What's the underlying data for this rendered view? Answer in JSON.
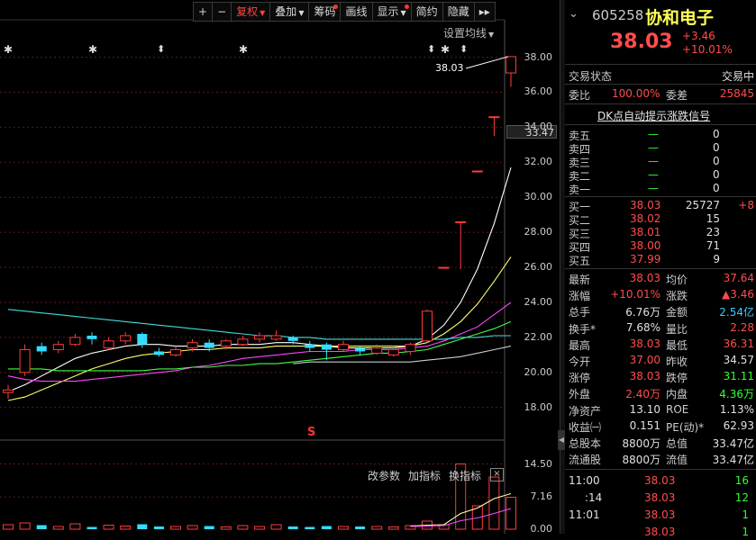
{
  "toolbar": {
    "buttons": [
      {
        "label": "+",
        "active": false,
        "dot": false,
        "caret": false
      },
      {
        "label": "−",
        "active": false,
        "dot": false,
        "caret": false
      },
      {
        "label": "复权",
        "active": true,
        "dot": false,
        "caret": true
      },
      {
        "label": "叠加",
        "active": false,
        "dot": false,
        "caret": true
      },
      {
        "label": "筹码",
        "active": false,
        "dot": true,
        "caret": false
      },
      {
        "label": "画线",
        "active": false,
        "dot": false,
        "caret": false
      },
      {
        "label": "显示",
        "active": false,
        "dot": true,
        "caret": true
      },
      {
        "label": "简约",
        "active": false,
        "dot": false,
        "caret": false
      },
      {
        "label": "隐藏",
        "active": false,
        "dot": false,
        "caret": false
      },
      {
        "label": "▸▸",
        "active": false,
        "dot": false,
        "caret": false
      }
    ]
  },
  "chart": {
    "ma_setting": "设置均线",
    "high_label": "38.03",
    "price_tag": "33.47",
    "s_marker": "S",
    "indicator_buttons": [
      "改参数",
      "加指标",
      "换指标"
    ],
    "close_glyph": "×",
    "star_glyph": "✱",
    "arrow_glyph": "⬍"
  },
  "chart_data": {
    "type": "candlestick",
    "price_axis": {
      "ticks": [
        "38.00",
        "36.00",
        "34.00",
        "32.00",
        "30.00",
        "28.00",
        "26.00",
        "24.00",
        "22.00",
        "20.00",
        "18.00"
      ],
      "ylim": [
        16.6,
        38.9
      ]
    },
    "volume_axis": {
      "ticks": [
        "14.50",
        "7.16",
        "0.00"
      ]
    },
    "candles": [
      {
        "o": 18.85,
        "c": 19.0,
        "h": 19.3,
        "l": 18.5
      },
      {
        "o": 20.0,
        "c": 21.3,
        "h": 21.6,
        "l": 19.8
      },
      {
        "o": 21.5,
        "c": 21.2,
        "h": 21.7,
        "l": 21.0
      },
      {
        "o": 21.3,
        "c": 21.6,
        "h": 21.8,
        "l": 21.1
      },
      {
        "o": 21.6,
        "c": 22.0,
        "h": 22.2,
        "l": 21.5
      },
      {
        "o": 22.1,
        "c": 21.9,
        "h": 22.3,
        "l": 21.6
      },
      {
        "o": 21.4,
        "c": 21.8,
        "h": 22.0,
        "l": 21.3
      },
      {
        "o": 21.8,
        "c": 22.1,
        "h": 22.3,
        "l": 21.6
      },
      {
        "o": 22.2,
        "c": 21.6,
        "h": 22.3,
        "l": 21.4
      },
      {
        "o": 21.2,
        "c": 21.0,
        "h": 21.4,
        "l": 20.9
      },
      {
        "o": 21.0,
        "c": 21.3,
        "h": 21.5,
        "l": 20.9
      },
      {
        "o": 21.4,
        "c": 21.7,
        "h": 21.9,
        "l": 21.2
      },
      {
        "o": 21.7,
        "c": 21.4,
        "h": 21.9,
        "l": 21.2
      },
      {
        "o": 21.5,
        "c": 21.8,
        "h": 21.9,
        "l": 21.3
      },
      {
        "o": 21.6,
        "c": 21.9,
        "h": 22.1,
        "l": 21.5
      },
      {
        "o": 21.9,
        "c": 22.1,
        "h": 22.3,
        "l": 21.7
      },
      {
        "o": 21.9,
        "c": 22.1,
        "h": 22.4,
        "l": 21.8
      },
      {
        "o": 22.0,
        "c": 21.8,
        "h": 22.1,
        "l": 21.6
      },
      {
        "o": 21.6,
        "c": 21.4,
        "h": 21.8,
        "l": 21.2
      },
      {
        "o": 21.6,
        "c": 21.3,
        "h": 21.7,
        "l": 20.7
      },
      {
        "o": 21.3,
        "c": 21.6,
        "h": 21.8,
        "l": 21.2
      },
      {
        "o": 21.4,
        "c": 21.2,
        "h": 21.5,
        "l": 21.0
      },
      {
        "o": 21.1,
        "c": 21.4,
        "h": 21.6,
        "l": 21.0
      },
      {
        "o": 21.0,
        "c": 21.3,
        "h": 21.5,
        "l": 20.9
      },
      {
        "o": 21.2,
        "c": 21.6,
        "h": 21.7,
        "l": 21.0
      },
      {
        "o": 21.8,
        "c": 23.5,
        "h": 23.6,
        "l": 21.7
      },
      {
        "o": 26.0,
        "c": 26.0,
        "h": 26.0,
        "l": 26.0
      },
      {
        "o": 28.6,
        "c": 28.6,
        "h": 28.6,
        "l": 25.9
      },
      {
        "o": 31.5,
        "c": 31.5,
        "h": 31.5,
        "l": 31.5
      },
      {
        "o": 34.6,
        "c": 34.6,
        "h": 34.6,
        "l": 33.5
      },
      {
        "o": 37.1,
        "c": 38.03,
        "h": 38.03,
        "l": 36.31
      }
    ],
    "ma_lines": [
      {
        "color": "#ffffff",
        "values": [
          18.9,
          19.3,
          19.8,
          20.3,
          20.8,
          21.1,
          21.3,
          21.5,
          21.6,
          21.6,
          21.5,
          21.5,
          21.5,
          21.6,
          21.6,
          21.6,
          21.7,
          21.7,
          21.6,
          21.5,
          21.4,
          21.4,
          21.4,
          21.4,
          21.5,
          21.9,
          22.7,
          24.0,
          25.9,
          28.5,
          31.7
        ]
      },
      {
        "color": "#ffff66",
        "values": [
          18.4,
          18.6,
          19.0,
          19.4,
          19.8,
          20.2,
          20.5,
          20.8,
          21.0,
          21.1,
          21.2,
          21.3,
          21.3,
          21.4,
          21.4,
          21.4,
          21.5,
          21.5,
          21.5,
          21.5,
          21.5,
          21.5,
          21.5,
          21.5,
          21.5,
          21.7,
          22.2,
          22.9,
          23.9,
          25.2,
          26.6
        ]
      },
      {
        "color": "#ff44ff",
        "values": [
          19.8,
          19.6,
          19.5,
          19.5,
          19.5,
          19.6,
          19.7,
          19.8,
          19.9,
          20.0,
          20.1,
          20.3,
          20.4,
          20.6,
          20.8,
          20.9,
          21.0,
          21.1,
          21.2,
          21.2,
          21.2,
          21.3,
          21.3,
          21.3,
          21.4,
          21.5,
          21.8,
          22.2,
          22.6,
          23.3,
          24.0
        ]
      },
      {
        "color": "#44ff44",
        "values": [
          20.2,
          20.2,
          20.2,
          20.1,
          20.1,
          20.1,
          20.1,
          20.1,
          20.1,
          20.2,
          20.2,
          20.3,
          20.3,
          20.4,
          20.4,
          20.5,
          20.5,
          20.6,
          20.7,
          20.8,
          20.9,
          21.0,
          21.1,
          21.1,
          21.2,
          21.3,
          21.6,
          21.9,
          22.2,
          22.5,
          22.9
        ]
      },
      {
        "color": "#44dddd",
        "values": [
          23.6,
          23.5,
          23.4,
          23.3,
          23.2,
          23.1,
          23.0,
          22.9,
          22.8,
          22.7,
          22.6,
          22.5,
          22.4,
          22.3,
          22.2,
          22.1,
          22.1,
          22.0,
          22.0,
          21.9,
          21.9,
          21.9,
          21.9,
          21.9,
          21.9,
          21.9,
          21.9,
          22.0,
          22.0,
          22.1,
          22.1
        ]
      },
      {
        "color": "#cccccc",
        "values": [
          null,
          null,
          null,
          null,
          null,
          null,
          null,
          null,
          null,
          null,
          null,
          null,
          null,
          null,
          null,
          null,
          null,
          20.5,
          20.6,
          20.6,
          20.6,
          20.6,
          20.6,
          20.6,
          20.6,
          20.7,
          20.8,
          20.9,
          21.1,
          21.3,
          21.5
        ]
      }
    ],
    "volume": [
      1.0,
      1.4,
      0.9,
      0.6,
      1.2,
      0.5,
      0.9,
      0.7,
      1.1,
      0.6,
      0.6,
      0.8,
      0.7,
      0.5,
      0.8,
      0.6,
      1.0,
      0.6,
      0.5,
      0.7,
      0.6,
      0.6,
      0.6,
      0.5,
      0.8,
      1.8,
      1.0,
      14.5,
      5.2,
      11.6,
      7.1
    ],
    "volume_ma": [
      {
        "color": "#ffffaa",
        "values": [
          null,
          null,
          null,
          null,
          null,
          null,
          null,
          null,
          null,
          null,
          null,
          null,
          null,
          null,
          null,
          null,
          null,
          null,
          null,
          null,
          null,
          null,
          null,
          null,
          0.7,
          0.9,
          1.0,
          3.5,
          4.7,
          6.8,
          7.9
        ]
      },
      {
        "color": "#ff44ff",
        "values": [
          null,
          null,
          null,
          null,
          null,
          null,
          null,
          null,
          null,
          null,
          null,
          null,
          null,
          null,
          null,
          null,
          null,
          null,
          null,
          null,
          null,
          null,
          null,
          null,
          0.6,
          0.7,
          0.8,
          1.9,
          2.5,
          3.5,
          4.6
        ]
      }
    ]
  },
  "quote": {
    "code": "605258",
    "name": "协和电子",
    "price": "38.03",
    "change": "+3.46",
    "change_pct": "+10.01%",
    "status_label": "交易状态",
    "status_value": "交易中",
    "wb_label": "委比",
    "wb_value": "100.00%",
    "wc_label": "委差",
    "wc_value": "25845",
    "signal_link": "DK点自动提示涨跌信号",
    "asks": [
      {
        "label": "卖五",
        "price": "—",
        "vol": "0"
      },
      {
        "label": "卖四",
        "price": "—",
        "vol": "0"
      },
      {
        "label": "卖三",
        "price": "—",
        "vol": "0"
      },
      {
        "label": "卖二",
        "price": "—",
        "vol": "0"
      },
      {
        "label": "卖一",
        "price": "—",
        "vol": "0"
      }
    ],
    "bids": [
      {
        "label": "买一",
        "price": "38.03",
        "vol": "25727",
        "diff": "+8"
      },
      {
        "label": "买二",
        "price": "38.02",
        "vol": "15",
        "diff": ""
      },
      {
        "label": "买三",
        "price": "38.01",
        "vol": "23",
        "diff": ""
      },
      {
        "label": "买四",
        "price": "38.00",
        "vol": "71",
        "diff": ""
      },
      {
        "label": "买五",
        "price": "37.99",
        "vol": "9",
        "diff": ""
      }
    ],
    "stats": [
      {
        "l1": "最新",
        "v1": "38.03",
        "c1": "r",
        "l2": "均价",
        "v2": "37.64",
        "c2": "r"
      },
      {
        "l1": "涨幅",
        "v1": "+10.01%",
        "c1": "r",
        "l2": "涨跌",
        "v2": "▲3.46",
        "c2": "r"
      },
      {
        "l1": "总手",
        "v1": "6.76万",
        "c1": "w",
        "l2": "金额",
        "v2": "2.54亿",
        "c2": "c"
      },
      {
        "l1": "换手*",
        "v1": "7.68%",
        "c1": "w",
        "l2": "量比",
        "v2": "2.28",
        "c2": "r"
      },
      {
        "l1": "最高",
        "v1": "38.03",
        "c1": "r",
        "l2": "最低",
        "v2": "36.31",
        "c2": "r"
      },
      {
        "l1": "今开",
        "v1": "37.00",
        "c1": "r",
        "l2": "昨收",
        "v2": "34.57",
        "c2": "w"
      },
      {
        "l1": "涨停",
        "v1": "38.03",
        "c1": "r",
        "l2": "跌停",
        "v2": "31.11",
        "c2": "g"
      },
      {
        "l1": "外盘",
        "v1": "2.40万",
        "c1": "r",
        "l2": "内盘",
        "v2": "4.36万",
        "c2": "g"
      },
      {
        "l1": "净资产",
        "v1": "13.10",
        "c1": "w",
        "l2": "ROE",
        "v2": "1.13%",
        "c2": "w"
      },
      {
        "l1": "收益㈠",
        "v1": "0.151",
        "c1": "w",
        "l2": "PE(动)*",
        "v2": "62.93",
        "c2": "w"
      },
      {
        "l1": "总股本",
        "v1": "8800万",
        "c1": "w",
        "l2": "总值",
        "v2": "33.47亿",
        "c2": "w"
      },
      {
        "l1": "流通股",
        "v1": "8800万",
        "c1": "w",
        "l2": "流值",
        "v2": "33.47亿",
        "c2": "w"
      }
    ],
    "ticks": [
      {
        "time": "11:00",
        "price": "38.03",
        "vol": "16"
      },
      {
        "time": ":14",
        "price": "38.03",
        "vol": "12"
      },
      {
        "time": "11:01",
        "price": "38.03",
        "vol": "1"
      },
      {
        "time": "",
        "price": "38.03",
        "vol": "1"
      }
    ]
  }
}
